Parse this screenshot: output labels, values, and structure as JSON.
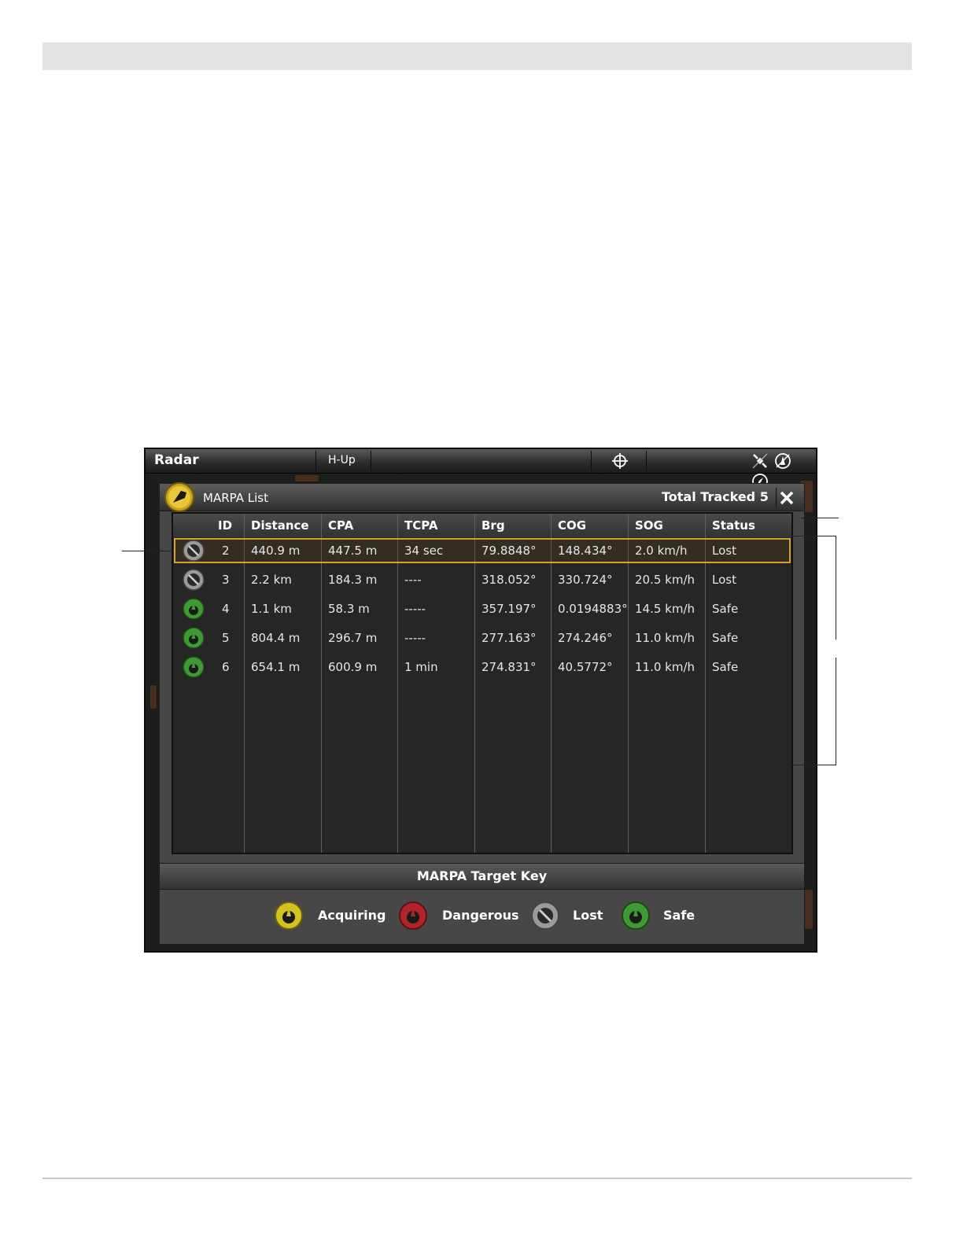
{
  "window": {
    "app_title": "Radar",
    "mode_label": "H-Up",
    "icons": [
      "crosshair-icon",
      "gps-icon",
      "heading-icon",
      "compass-icon"
    ]
  },
  "marpa_panel": {
    "title": "MARPA List",
    "total_tracked_label": "Total Tracked 5",
    "close_icon": "close-icon",
    "columns": [
      "ID",
      "Distance",
      "CPA",
      "TCPA",
      "Brg",
      "COG",
      "SOG",
      "Status"
    ],
    "rows": [
      {
        "icon": "lost",
        "id": "2",
        "distance": "440.9 m",
        "cpa": "447.5 m",
        "tcpa": "34 sec",
        "brg": "79.8848°",
        "cog": "148.434°",
        "sog": "2.0 km/h",
        "status": "Lost",
        "selected": true
      },
      {
        "icon": "lost",
        "id": "3",
        "distance": "2.2 km",
        "cpa": "184.3 m",
        "tcpa": "----",
        "brg": "318.052°",
        "cog": "330.724°",
        "sog": "20.5 km/h",
        "status": "Lost"
      },
      {
        "icon": "safe",
        "id": "4",
        "distance": "1.1 km",
        "cpa": "58.3 m",
        "tcpa": "-----",
        "brg": "357.197°",
        "cog": "0.0194883°",
        "sog": "14.5 km/h",
        "status": "Safe"
      },
      {
        "icon": "safe",
        "id": "5",
        "distance": "804.4 m",
        "cpa": "296.7 m",
        "tcpa": "-----",
        "brg": "277.163°",
        "cog": "274.246°",
        "sog": "11.0 km/h",
        "status": "Safe"
      },
      {
        "icon": "safe",
        "id": "6",
        "distance": "654.1 m",
        "cpa": "600.9 m",
        "tcpa": "1 min",
        "brg": "274.831°",
        "cog": "40.5772°",
        "sog": "11.0 km/h",
        "status": "Safe"
      }
    ],
    "target_key": {
      "title": "MARPA Target Key",
      "items": [
        {
          "label": "Acquiring",
          "color": "#d6c21e"
        },
        {
          "label": "Dangerous",
          "color": "#b3232b"
        },
        {
          "label": "Lost",
          "color": "#9a9a9a"
        },
        {
          "label": "Safe",
          "color": "#3f9a35"
        }
      ]
    }
  },
  "colors": {
    "highlight": "#d9a02b",
    "acquiring": "#d6c21e",
    "dangerous": "#b3232b",
    "lost": "#9a9a9a",
    "safe": "#3f9a35"
  }
}
